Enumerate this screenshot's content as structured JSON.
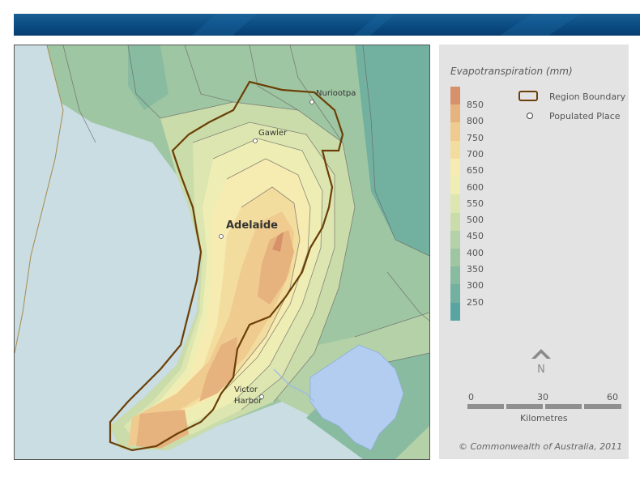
{
  "legend": {
    "title": "Evapotranspiration (mm)",
    "scale": [
      {
        "label": "850",
        "color": "#d6916a"
      },
      {
        "label": "800",
        "color": "#e6b27e"
      },
      {
        "label": "750",
        "color": "#efcb8f"
      },
      {
        "label": "700",
        "color": "#f3dd9e"
      },
      {
        "label": "650",
        "color": "#f6ebb0"
      },
      {
        "label": "600",
        "color": "#eeeeb4"
      },
      {
        "label": "550",
        "color": "#dde6b0"
      },
      {
        "label": "500",
        "color": "#cbdcab"
      },
      {
        "label": "450",
        "color": "#b4d1a7"
      },
      {
        "label": "400",
        "color": "#9fc6a2"
      },
      {
        "label": "350",
        "color": "#88bba0"
      },
      {
        "label": "300",
        "color": "#72b0a0"
      },
      {
        "label": "250",
        "color": "#5aa5a3"
      }
    ],
    "region_boundary": "Region Boundary",
    "populated_place": "Populated Place",
    "north_label": "N",
    "scalebar": {
      "ticks": [
        "0",
        "30",
        "60"
      ],
      "unit": "Kilometres"
    },
    "copyright": "© Commonwealth of Australia, 2011"
  },
  "map": {
    "places": [
      {
        "name": "Nuriootpa"
      },
      {
        "name": "Gawler"
      },
      {
        "name": "Adelaide"
      },
      {
        "name": "Victor"
      },
      {
        "name": "Harbor"
      }
    ]
  }
}
